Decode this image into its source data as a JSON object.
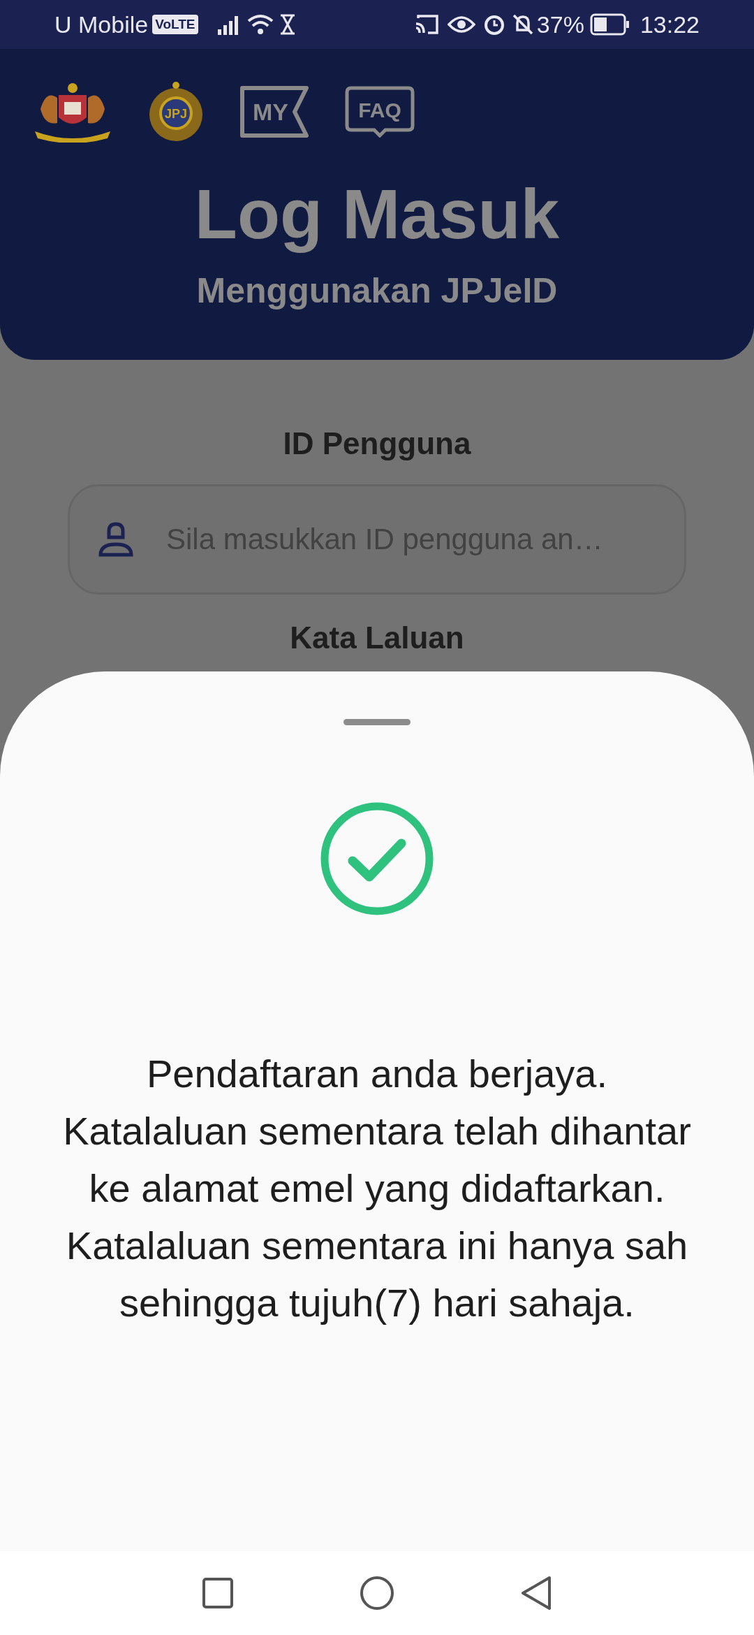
{
  "status_bar": {
    "carrier": "U Mobile",
    "network_badge": "VoLTE",
    "battery": "37%",
    "time": "13:22"
  },
  "header": {
    "emblem_text": "JPJ",
    "buttons": [
      {
        "kind": "my",
        "label": "MY"
      },
      {
        "kind": "faq",
        "label": "FAQ"
      }
    ],
    "title": "Log Masuk",
    "subtitle": "Menggunakan JPJeID"
  },
  "form": {
    "fields": [
      {
        "label": "ID Pengguna",
        "placeholder": "Sila masukkan ID pengguna an…"
      }
    ],
    "next_label": "Kata Laluan"
  },
  "sheet": {
    "message": [
      "Pendaftaran anda berjaya.",
      "Katalaluan sementara telah dihantar ke alamat emel yang didaftarkan.",
      "Katalaluan sementara ini hanya sah sehingga tujuh(7) hari sahaja."
    ]
  }
}
